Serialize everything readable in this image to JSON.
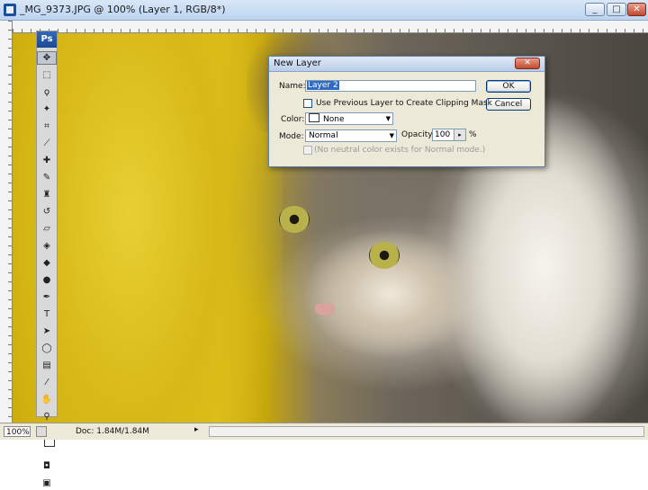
{
  "window": {
    "title": "_MG_9373.JPG @ 100% (Layer 1, RGB/8*)",
    "buttons": {
      "minimize": "_",
      "restore": "□",
      "close": "✕"
    }
  },
  "toolbox": {
    "logo": "Ps",
    "tools": [
      {
        "name": "move-tool",
        "glyph": "✥"
      },
      {
        "name": "marquee-tool",
        "glyph": "⬚"
      },
      {
        "name": "lasso-tool",
        "glyph": "ϙ"
      },
      {
        "name": "magic-wand-tool",
        "glyph": "✦"
      },
      {
        "name": "crop-tool",
        "glyph": "⌗"
      },
      {
        "name": "slice-tool",
        "glyph": "⟋"
      },
      {
        "name": "healing-brush-tool",
        "glyph": "✚"
      },
      {
        "name": "brush-tool",
        "glyph": "✎"
      },
      {
        "name": "clone-stamp-tool",
        "glyph": "♜"
      },
      {
        "name": "history-brush-tool",
        "glyph": "↺"
      },
      {
        "name": "eraser-tool",
        "glyph": "▱"
      },
      {
        "name": "paint-bucket-tool",
        "glyph": "◈"
      },
      {
        "name": "blur-tool",
        "glyph": "◆"
      },
      {
        "name": "dodge-tool",
        "glyph": "●"
      },
      {
        "name": "pen-tool",
        "glyph": "✒"
      },
      {
        "name": "type-tool",
        "glyph": "T"
      },
      {
        "name": "path-selection-tool",
        "glyph": "➤"
      },
      {
        "name": "shape-tool",
        "glyph": "◯"
      },
      {
        "name": "notes-tool",
        "glyph": "▤"
      },
      {
        "name": "eyedropper-tool",
        "glyph": "⁄"
      },
      {
        "name": "hand-tool",
        "glyph": "✋"
      },
      {
        "name": "zoom-tool",
        "glyph": "⚲"
      }
    ]
  },
  "status": {
    "zoom": "100%",
    "doc": "Doc: 1.84M/1.84M",
    "arrow": "▸"
  },
  "dialog": {
    "title": "New Layer",
    "close": "✕",
    "name_label": "Name:",
    "name_value": "Layer 2",
    "clip_label": "Use Previous Layer to Create Clipping Mask",
    "color_label": "Color:",
    "color_value": "None",
    "mode_label": "Mode:",
    "mode_value": "Normal",
    "opacity_label": "Opacity:",
    "opacity_value": "100",
    "opacity_unit": "%",
    "neutral_label": "(No neutral color exists for Normal mode.)",
    "ok": "OK",
    "cancel": "Cancel"
  }
}
